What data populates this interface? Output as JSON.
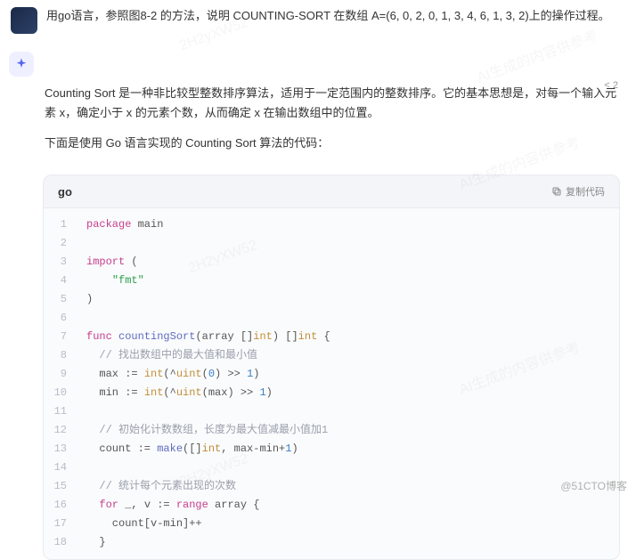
{
  "question": "用go语言，参照图8-2 的方法，说明 COUNTING-SORT 在数组 A=(6, 0, 2, 0, 1, 3, 4, 6, 1, 3, 2)上的操作过程。",
  "reply_indicator": "< 2",
  "answer": {
    "p1": "Counting Sort 是一种非比较型整数排序算法，适用于一定范围内的整数排序。它的基本思想是，对每一个输入元素 x，确定小于 x 的元素个数，从而确定 x 在输出数组中的位置。",
    "p2": "下面是使用 Go 语言实现的 Counting Sort 算法的代码："
  },
  "code": {
    "lang": "go",
    "copy_label": "复制代码",
    "lines": [
      {
        "n": 1,
        "tokens": [
          {
            "t": "package ",
            "c": "kw"
          },
          {
            "t": "main"
          }
        ]
      },
      {
        "n": 2,
        "tokens": [
          {
            "t": ""
          }
        ]
      },
      {
        "n": 3,
        "tokens": [
          {
            "t": "import ",
            "c": "kw"
          },
          {
            "t": "("
          }
        ]
      },
      {
        "n": 4,
        "tokens": [
          {
            "t": "    "
          },
          {
            "t": "\"fmt\"",
            "c": "str"
          }
        ]
      },
      {
        "n": 5,
        "tokens": [
          {
            "t": ")"
          }
        ]
      },
      {
        "n": 6,
        "tokens": [
          {
            "t": ""
          }
        ]
      },
      {
        "n": 7,
        "tokens": [
          {
            "t": "func ",
            "c": "kw"
          },
          {
            "t": "countingSort",
            "c": "fn"
          },
          {
            "t": "(array []"
          },
          {
            "t": "int",
            "c": "typ"
          },
          {
            "t": ") []"
          },
          {
            "t": "int",
            "c": "typ"
          },
          {
            "t": " {"
          }
        ]
      },
      {
        "n": 8,
        "tokens": [
          {
            "t": "  "
          },
          {
            "t": "// 找出数组中的最大值和最小值",
            "c": "cmt"
          }
        ]
      },
      {
        "n": 9,
        "tokens": [
          {
            "t": "  max := "
          },
          {
            "t": "int",
            "c": "typ"
          },
          {
            "t": "(^"
          },
          {
            "t": "uint",
            "c": "typ"
          },
          {
            "t": "("
          },
          {
            "t": "0",
            "c": "num"
          },
          {
            "t": ") >> "
          },
          {
            "t": "1",
            "c": "num"
          },
          {
            "t": ")"
          }
        ]
      },
      {
        "n": 10,
        "tokens": [
          {
            "t": "  min := "
          },
          {
            "t": "int",
            "c": "typ"
          },
          {
            "t": "(^"
          },
          {
            "t": "uint",
            "c": "typ"
          },
          {
            "t": "(max) >> "
          },
          {
            "t": "1",
            "c": "num"
          },
          {
            "t": ")"
          }
        ]
      },
      {
        "n": 11,
        "tokens": [
          {
            "t": ""
          }
        ]
      },
      {
        "n": 12,
        "tokens": [
          {
            "t": "  "
          },
          {
            "t": "// 初始化计数数组，长度为最大值减最小值加1",
            "c": "cmt"
          }
        ]
      },
      {
        "n": 13,
        "tokens": [
          {
            "t": "  count := "
          },
          {
            "t": "make",
            "c": "fn"
          },
          {
            "t": "([]"
          },
          {
            "t": "int",
            "c": "typ"
          },
          {
            "t": ", max-min+"
          },
          {
            "t": "1",
            "c": "num"
          },
          {
            "t": ")"
          }
        ]
      },
      {
        "n": 14,
        "tokens": [
          {
            "t": ""
          }
        ]
      },
      {
        "n": 15,
        "tokens": [
          {
            "t": "  "
          },
          {
            "t": "// 统计每个元素出现的次数",
            "c": "cmt"
          }
        ]
      },
      {
        "n": 16,
        "tokens": [
          {
            "t": "  "
          },
          {
            "t": "for ",
            "c": "kw"
          },
          {
            "t": "_, v := "
          },
          {
            "t": "range ",
            "c": "kw"
          },
          {
            "t": "array {"
          }
        ]
      },
      {
        "n": 17,
        "tokens": [
          {
            "t": "    count[v-min]++"
          }
        ]
      },
      {
        "n": 18,
        "tokens": [
          {
            "t": "  }"
          }
        ]
      }
    ]
  },
  "watermarks": [
    "AI生成的内容供参考",
    "2H2yXW52",
    "AI生成的内容供参考",
    "2H2yXW52",
    "AI生成的内容供参考",
    "AI生成的内容供参考"
  ],
  "footer_wm": "@51CTO博客"
}
